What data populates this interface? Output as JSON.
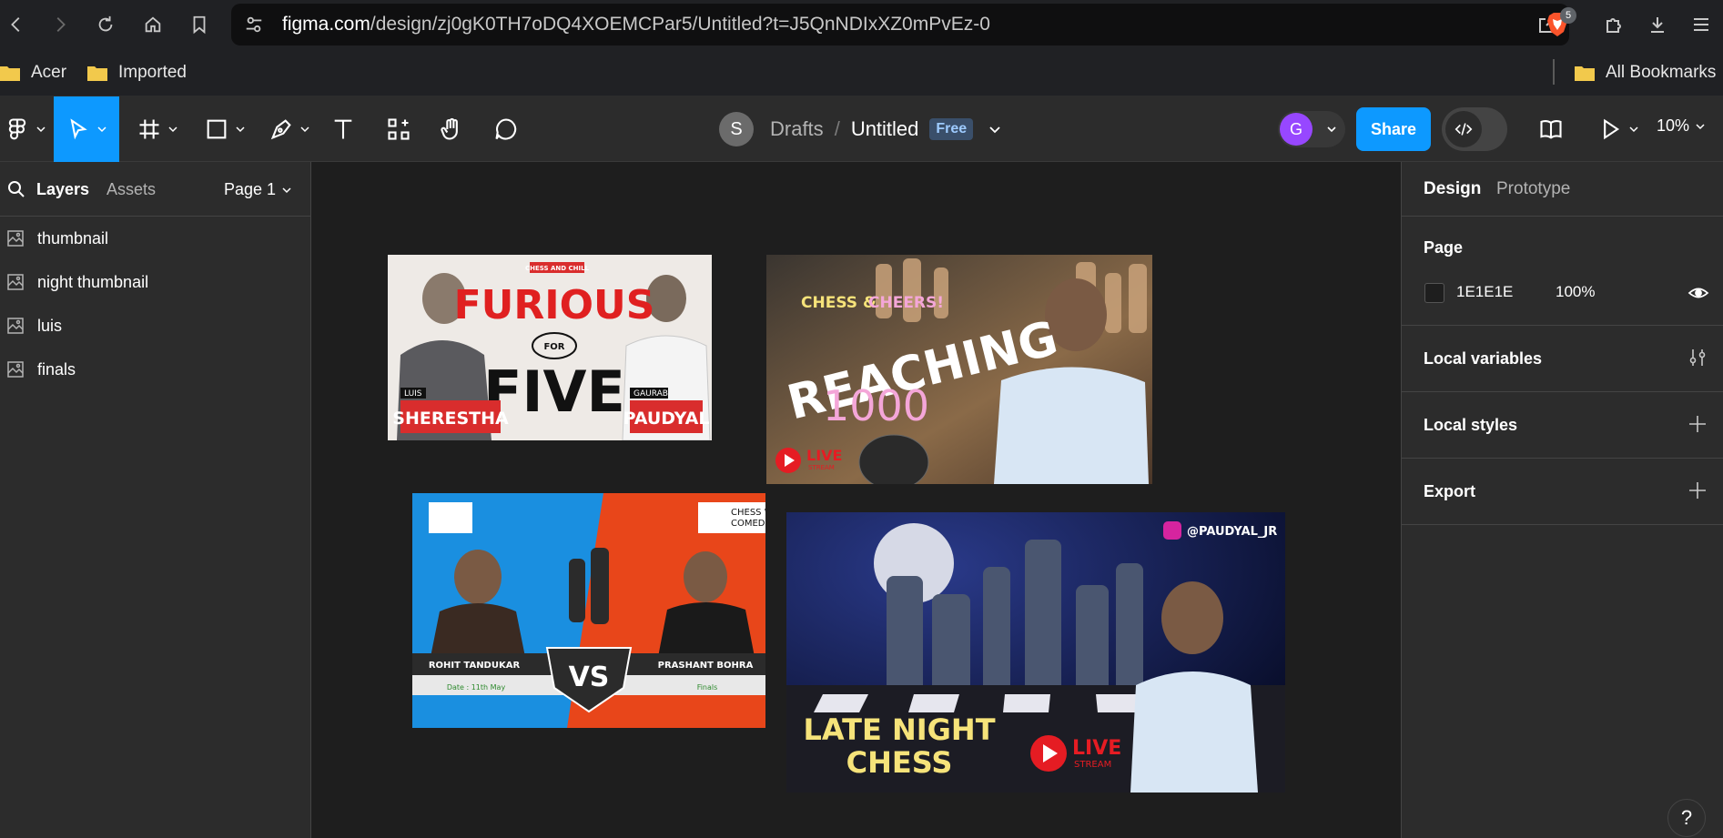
{
  "browser": {
    "url_host": "figma.com",
    "url_path": "/design/zj0gK0TH7oDQ4XOEMCPar5/Untitled?t=J5QnNDIxXZ0mPvEz-0",
    "brave_badge": "5",
    "bookmarks": [
      "Acer",
      "Imported"
    ],
    "all_bookmarks": "All Bookmarks"
  },
  "file": {
    "team_initial": "S",
    "location": "Drafts",
    "separator": "/",
    "name": "Untitled",
    "plan_badge": "Free"
  },
  "toolbar": {
    "user_initial": "G",
    "share_label": "Share",
    "zoom_level": "10%"
  },
  "left_panel": {
    "tabs": [
      "Layers",
      "Assets"
    ],
    "page_selector": "Page 1",
    "layers": [
      "thumbnail",
      "night thumbnail",
      "luis",
      "finals"
    ]
  },
  "right_panel": {
    "tabs": [
      "Design",
      "Prototype"
    ],
    "page_label": "Page",
    "page_color": "1E1E1E",
    "page_opacity": "100%",
    "sections": [
      "Local variables",
      "Local styles",
      "Export"
    ]
  },
  "canvas": {
    "thumbnails": {
      "furious": {
        "tagline": "CHESS AND CHILL",
        "title_top": "FURIOUS",
        "for": "FOR",
        "title_bottom": "FIVE",
        "left_first": "LUIS",
        "left_last": "SHERESTHA",
        "right_first": "GAURAB",
        "right_last": "PAUDYAL"
      },
      "reaching": {
        "tagline_a": "CHESS &",
        "tagline_b": "CHEERS!",
        "title": "REACHING",
        "number": "1000",
        "live": "LIVE",
        "stream": "STREAM"
      },
      "finals": {
        "left_name": "ROHIT TANDUKAR",
        "right_name": "PRASHANT BOHRA",
        "vs": "VS",
        "date": "Date : 11th May",
        "stage": "Finals",
        "sponsor": "CHESS W",
        "sponsor2": "COMEDI"
      },
      "night": {
        "handle": "@PAUDYAL_JR",
        "title_line1": "LATE NIGHT",
        "title_line2": "CHESS",
        "live": "LIVE",
        "stream": "STREAM"
      }
    }
  },
  "colors": {
    "figma_blue": "#0d99ff",
    "canvas_bg": "#1e1e1e",
    "panel_bg": "#2c2c2c"
  }
}
